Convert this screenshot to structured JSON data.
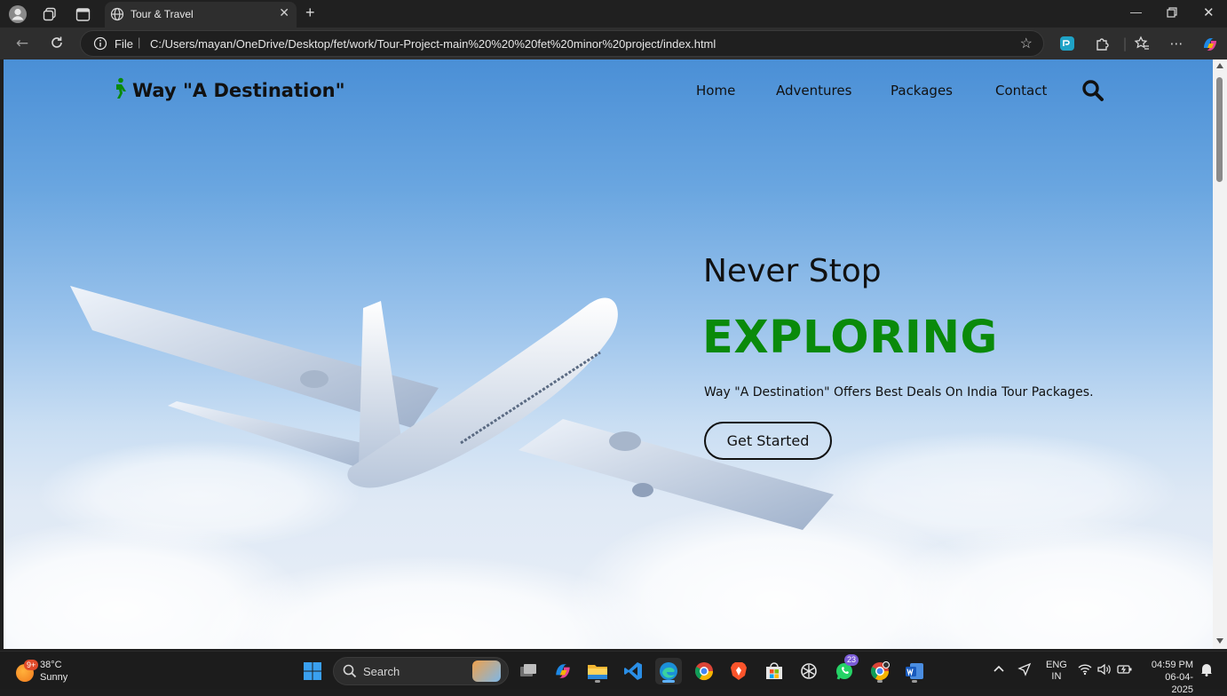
{
  "browser": {
    "tab_title": "Tour & Travel",
    "address_scheme": "File",
    "url": "C:/Users/mayan/OneDrive/Desktop/fet/work/Tour-Project-main%20%20%20fet%20minor%20project/index.html"
  },
  "site": {
    "brand": "Way \"A Destination\"",
    "nav": [
      "Home",
      "Adventures",
      "Packages",
      "Contact"
    ],
    "hero": {
      "subtitle": "Never Stop",
      "title": "EXPLORING",
      "text": "Way \"A Destination\" Offers Best Deals On India Tour Packages.",
      "cta": "Get Started"
    },
    "colors": {
      "accent_green": "#0a8a0a",
      "sky_top": "#4a8fd6",
      "sky_bottom": "#e9eff7"
    }
  },
  "taskbar": {
    "weather": {
      "temp": "38°C",
      "condition": "Sunny",
      "badge": "9+"
    },
    "search_label": "Search",
    "whatsapp_badge": "23",
    "language": {
      "line1": "ENG",
      "line2": "IN"
    },
    "time": "04:59 PM",
    "date": "06-04-2025"
  }
}
